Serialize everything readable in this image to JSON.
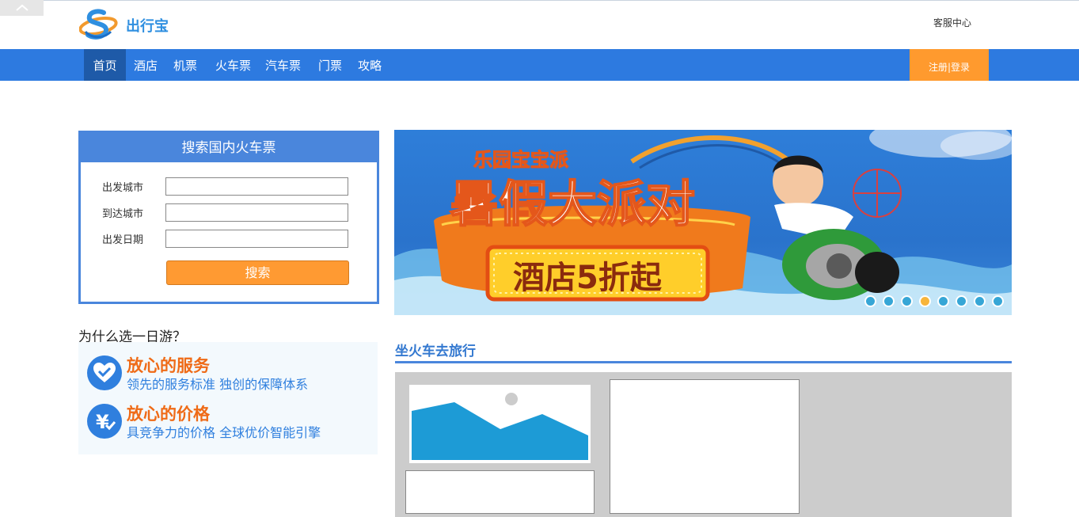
{
  "app": {
    "name": "出行宝"
  },
  "header": {
    "service_link": "客服中心"
  },
  "nav": {
    "items": [
      {
        "label": "首页",
        "active": true
      },
      {
        "label": "酒店",
        "active": false
      },
      {
        "label": "机票",
        "active": false
      },
      {
        "label": "火车票",
        "active": false
      },
      {
        "label": "汽车票",
        "active": false
      },
      {
        "label": "门票",
        "active": false
      },
      {
        "label": "攻略",
        "active": false
      }
    ],
    "login_label": "注册|登录"
  },
  "search": {
    "title": "搜索国内火车票",
    "fields": [
      {
        "label": "出发城市",
        "value": "",
        "placeholder": ""
      },
      {
        "label": "到达城市",
        "value": "",
        "placeholder": ""
      },
      {
        "label": "出发日期",
        "value": "",
        "placeholder": ""
      }
    ],
    "button_label": "搜索"
  },
  "why": {
    "title": "为什么选一日游？",
    "items": [
      {
        "icon": "heart-check-icon",
        "heading": "放心的服务",
        "subtitle": "领先的服务标准 独创的保障体系"
      },
      {
        "icon": "yen-check-icon",
        "heading": "放心的价格",
        "subtitle": "具竞争力的价格 全球优价智能引擎"
      }
    ]
  },
  "banner": {
    "headline_top": "乐园宝宝派",
    "headline_main": "暑假大派对",
    "badge": "酒店5折起",
    "dot_count": 8,
    "active_dot": 3
  },
  "section": {
    "title": "坐火车去旅行"
  },
  "colors": {
    "brand_blue": "#2d7ae0",
    "accent_orange": "#ff9a2e",
    "headline_orange": "#ef6b17"
  }
}
